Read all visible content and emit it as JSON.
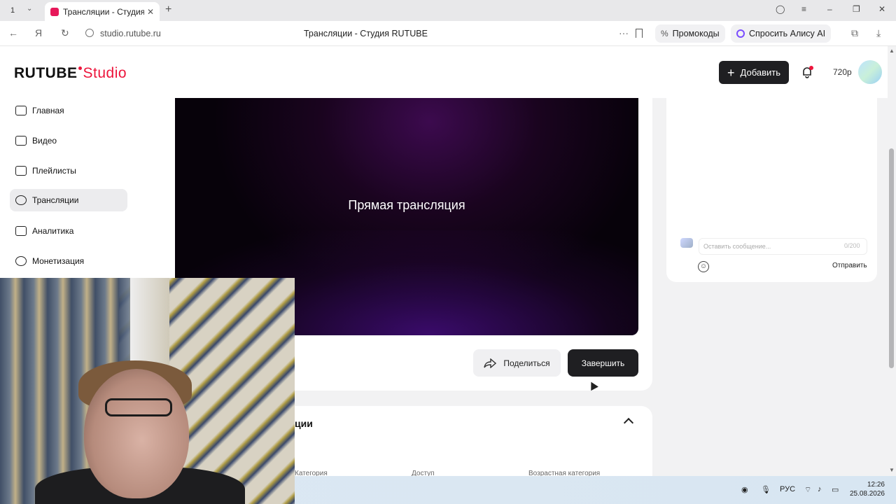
{
  "browser": {
    "tab_count": "1",
    "tab_title": "Трансляции - Студия R",
    "url": "studio.rutube.ru",
    "page_title": "Трансляции - Студия RUTUBE",
    "promo_label": "Промокоды",
    "alice_label": "Спросить Алису AI"
  },
  "header": {
    "logo_main": "RUTUBE",
    "logo_studio": "Studio",
    "add_label": "Добавить",
    "quality": "720p"
  },
  "sidebar": {
    "items": [
      {
        "label": "Главная"
      },
      {
        "label": "Видео"
      },
      {
        "label": "Плейлисты"
      },
      {
        "label": "Трансляции"
      },
      {
        "label": "Аналитика"
      },
      {
        "label": "Монетизация"
      }
    ]
  },
  "player": {
    "title": "Прямая трансляция"
  },
  "actions": {
    "share_label": "Поделиться",
    "finish_label": "Завершить"
  },
  "info": {
    "section_title": "ции",
    "col_category": "Категория",
    "col_access": "Доступ",
    "col_age": "Возрастная категория"
  },
  "chat": {
    "placeholder": "Оставить сообщение...",
    "counter": "0/200",
    "send_label": "Отправить"
  },
  "taskbar": {
    "lang": "РУС",
    "time": "12:26",
    "date": "25.08.2026"
  }
}
